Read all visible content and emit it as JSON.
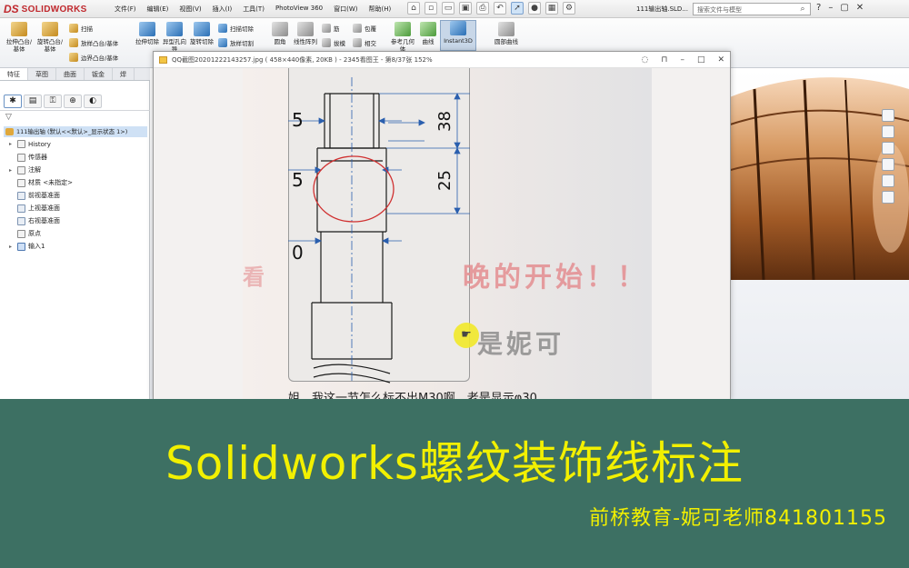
{
  "menubar": {
    "logo_ds": "DS",
    "logo_text": "SOLIDWORKS",
    "menus": [
      "文件(F)",
      "编辑(E)",
      "视图(V)",
      "插入(I)",
      "工具(T)",
      "PhotoView 360",
      "窗口(W)",
      "帮助(H)"
    ],
    "doc_title": "111输出轴.SLD...",
    "search_placeholder": "搜索文件与模型"
  },
  "commands": {
    "extrude_boss": "拉伸凸台/基体",
    "revolve_boss": "旋转凸台/基体",
    "sweep": "扫描",
    "loft": "放样凸台/基体",
    "boundary": "边界凸台/基体",
    "extrude_cut": "拉伸切除",
    "hole_wizard": "异型孔向导",
    "revolve_cut": "旋转切除",
    "sweep_cut": "扫描切除",
    "loft_cut": "放样切割",
    "fillet": "圆角",
    "linear_pattern": "线性阵列",
    "rib": "筋",
    "draft": "拔模",
    "wrap": "包覆",
    "intersect": "相交",
    "ref_geometry": "参考几何体",
    "curves": "曲线",
    "instant3d": "Instant3D",
    "section_view": "圆部曲线"
  },
  "tabs": [
    "特征",
    "草图",
    "曲面",
    "钣金",
    "焊"
  ],
  "tree": {
    "root": "111输出轴 (默认<<默认>_显示状态 1>)",
    "items": [
      "History",
      "传感器",
      "注解",
      "材质 <未指定>",
      "前视基准面",
      "上视基准面",
      "右视基准面",
      "原点",
      "输入1"
    ]
  },
  "viewer": {
    "title": "QQ截图20201222143257.jpg ( 458×440像素, 20KB ) - 2345看图王 - 第8/37张 152%",
    "dim_38": "38",
    "dim_25": "25",
    "dim_5a": "5",
    "dim_5b": "5",
    "dim_0": "0",
    "watermark1": "晚的开始！！",
    "watermark2": "是妮可",
    "subtitle": "姐，我这一节怎么标不出M30啊，老是显示φ30",
    "cursor_icon": "☛"
  },
  "banner": {
    "title": "Solidworks螺纹装饰线标注",
    "subtitle": "前桥教育-妮可老师841801155"
  },
  "colors": {
    "banner_bg": "#3d7063",
    "banner_text": "#f2f000",
    "accent_blue": "#2a5fae"
  }
}
